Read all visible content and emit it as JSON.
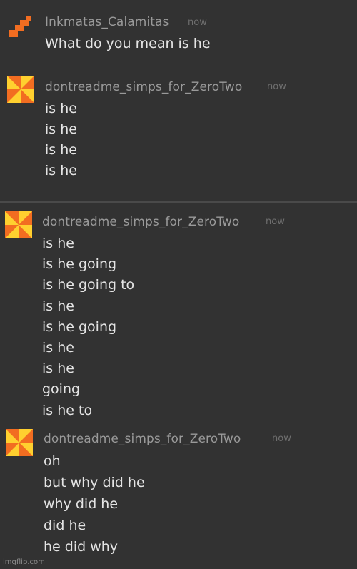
{
  "messages": [
    {
      "username": "Inkmatas_Calamitas",
      "timestamp": "now",
      "avatar_icon": "orange-pixel-staircase-icon",
      "lines": [
        "What do you mean is he"
      ]
    },
    {
      "username": "dontreadme_simps_for_ZeroTwo",
      "timestamp": "now",
      "avatar_icon": "pinwheel-icon",
      "lines": [
        "is he",
        "is he",
        "is he",
        "is he"
      ]
    },
    {
      "username": "dontreadme_simps_for_ZeroTwo",
      "timestamp": "now",
      "avatar_icon": "pinwheel-icon",
      "lines": [
        "is he",
        "is he going",
        "is he going to",
        "is he",
        "is he going",
        "is he",
        "is he",
        "going",
        "is he to"
      ]
    },
    {
      "username": "dontreadme_simps_for_ZeroTwo",
      "timestamp": "now",
      "avatar_icon": "pinwheel-icon",
      "lines": [
        "oh",
        "but why did he",
        "why did he",
        "did he",
        "he did why"
      ]
    }
  ],
  "watermark": "imgflip.com",
  "colors": {
    "background": "#323232",
    "username": "#9a9a9a",
    "timestamp": "#6f6f6f",
    "message_text": "#e4e4e4",
    "avatar_orange": "#f26d21",
    "avatar_yellow": "#ffd02f"
  }
}
